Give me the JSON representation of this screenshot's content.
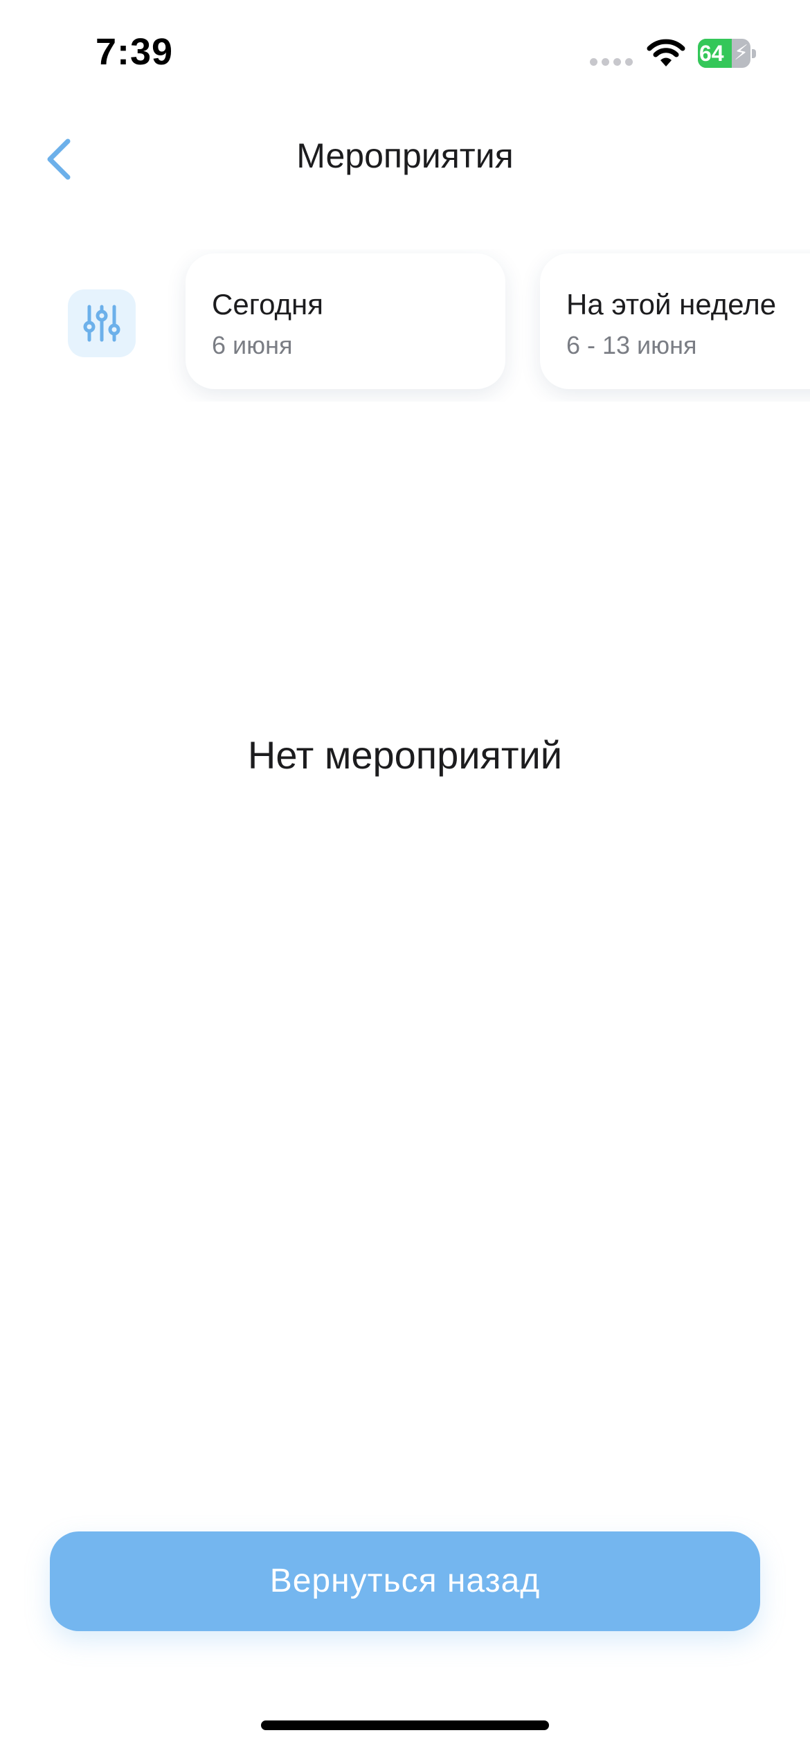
{
  "status_bar": {
    "time": "7:39",
    "battery_percent": "64",
    "battery_level": 0.64,
    "charging_symbol": "⚡",
    "icons": [
      "cellular-signal-icon",
      "wifi-icon",
      "battery-charging-icon"
    ]
  },
  "nav": {
    "title": "Мероприятия",
    "back_icon": "chevron-left-icon"
  },
  "filters": {
    "filter_icon": "sliders-icon",
    "chips": [
      {
        "title": "Сегодня",
        "subtitle": "6 июня"
      },
      {
        "title": "На этой неделе",
        "subtitle": "6 - 13 июня"
      }
    ]
  },
  "empty_state": {
    "message": "Нет мероприятий"
  },
  "footer": {
    "button_label": "Вернуться назад"
  },
  "colors": {
    "accent": "#74b6ef",
    "icon_blue": "#6cb0ea",
    "filter_bg": "#e6f3fd",
    "battery_green": "#34c759",
    "secondary_text": "#7a7d84"
  }
}
